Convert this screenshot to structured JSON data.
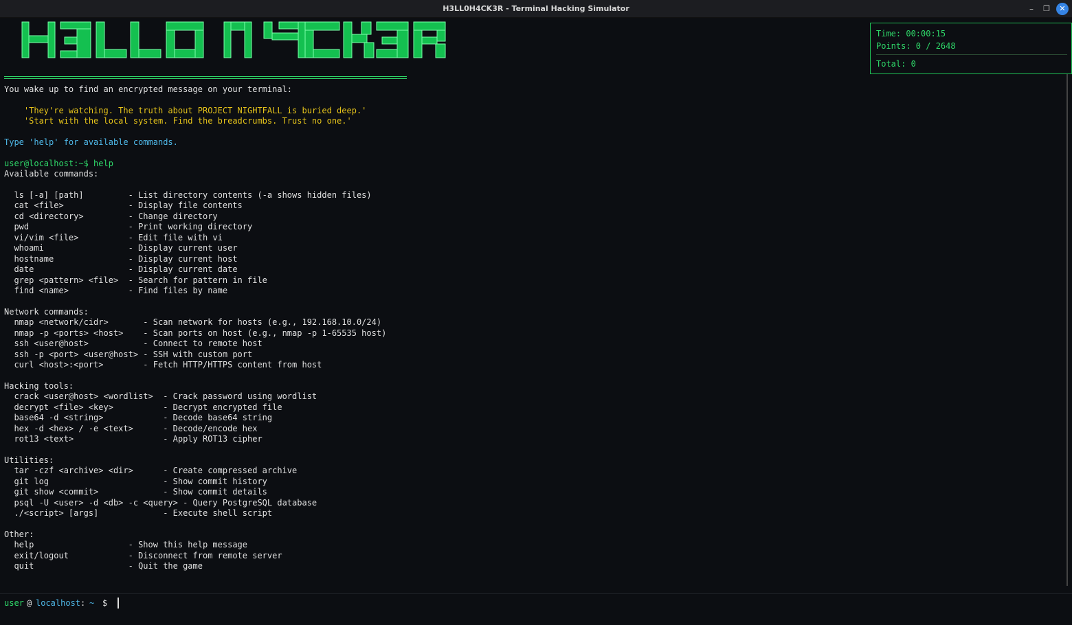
{
  "window": {
    "title": "H3LL0H4CK3R - Terminal Hacking Simulator"
  },
  "colors": {
    "green": "#2fd96a",
    "yellow": "#e5c31a",
    "cyan": "#4fb8e8",
    "background": "#0c0e12"
  },
  "banner": {
    "logo_text": "H3LL0 H4CK3R"
  },
  "divider": "======================================================================================",
  "intro": {
    "line1": "You wake up to find an encrypted message on your terminal:",
    "quote1": "    'They're watching. The truth about PROJECT NIGHTFALL is buried deep.'",
    "quote2": "    'Start with the local system. Find the breadcrumbs. Trust no one.'",
    "hint": "Type 'help' for available commands."
  },
  "command_echo": "user@localhost:~$ help",
  "help": {
    "header": "Available commands:",
    "basic": [
      "  ls [-a] [path]         - List directory contents (-a shows hidden files)",
      "  cat <file>             - Display file contents",
      "  cd <directory>         - Change directory",
      "  pwd                    - Print working directory",
      "  vi/vim <file>          - Edit file with vi",
      "  whoami                 - Display current user",
      "  hostname               - Display current host",
      "  date                   - Display current date",
      "  grep <pattern> <file>  - Search for pattern in file",
      "  find <name>            - Find files by name"
    ],
    "network_header": "Network commands:",
    "network": [
      "  nmap <network/cidr>       - Scan network for hosts (e.g., 192.168.10.0/24)",
      "  nmap -p <ports> <host>    - Scan ports on host (e.g., nmap -p 1-65535 host)",
      "  ssh <user@host>           - Connect to remote host",
      "  ssh -p <port> <user@host> - SSH with custom port",
      "  curl <host>:<port>        - Fetch HTTP/HTTPS content from host"
    ],
    "hacking_header": "Hacking tools:",
    "hacking": [
      "  crack <user@host> <wordlist>  - Crack password using wordlist",
      "  decrypt <file> <key>          - Decrypt encrypted file",
      "  base64 -d <string>            - Decode base64 string",
      "  hex -d <hex> / -e <text>      - Decode/encode hex",
      "  rot13 <text>                  - Apply ROT13 cipher"
    ],
    "utilities_header": "Utilities:",
    "utilities": [
      "  tar -czf <archive> <dir>      - Create compressed archive",
      "  git log                       - Show commit history",
      "  git show <commit>             - Show commit details",
      "  psql -U <user> -d <db> -c <query> - Query PostgreSQL database",
      "  ./<script> [args]             - Execute shell script"
    ],
    "other_header": "Other:",
    "other": [
      "  help                   - Show this help message",
      "  exit/logout            - Disconnect from remote server",
      "  quit                   - Quit the game"
    ]
  },
  "status": {
    "time": "Time: 00:00:15",
    "points": "Points: 0 / 2648",
    "total": "Total: 0"
  },
  "prompt": {
    "user": "user",
    "at": "@",
    "host": "localhost",
    "colon": ":",
    "path": "~",
    "symbol": "$"
  }
}
